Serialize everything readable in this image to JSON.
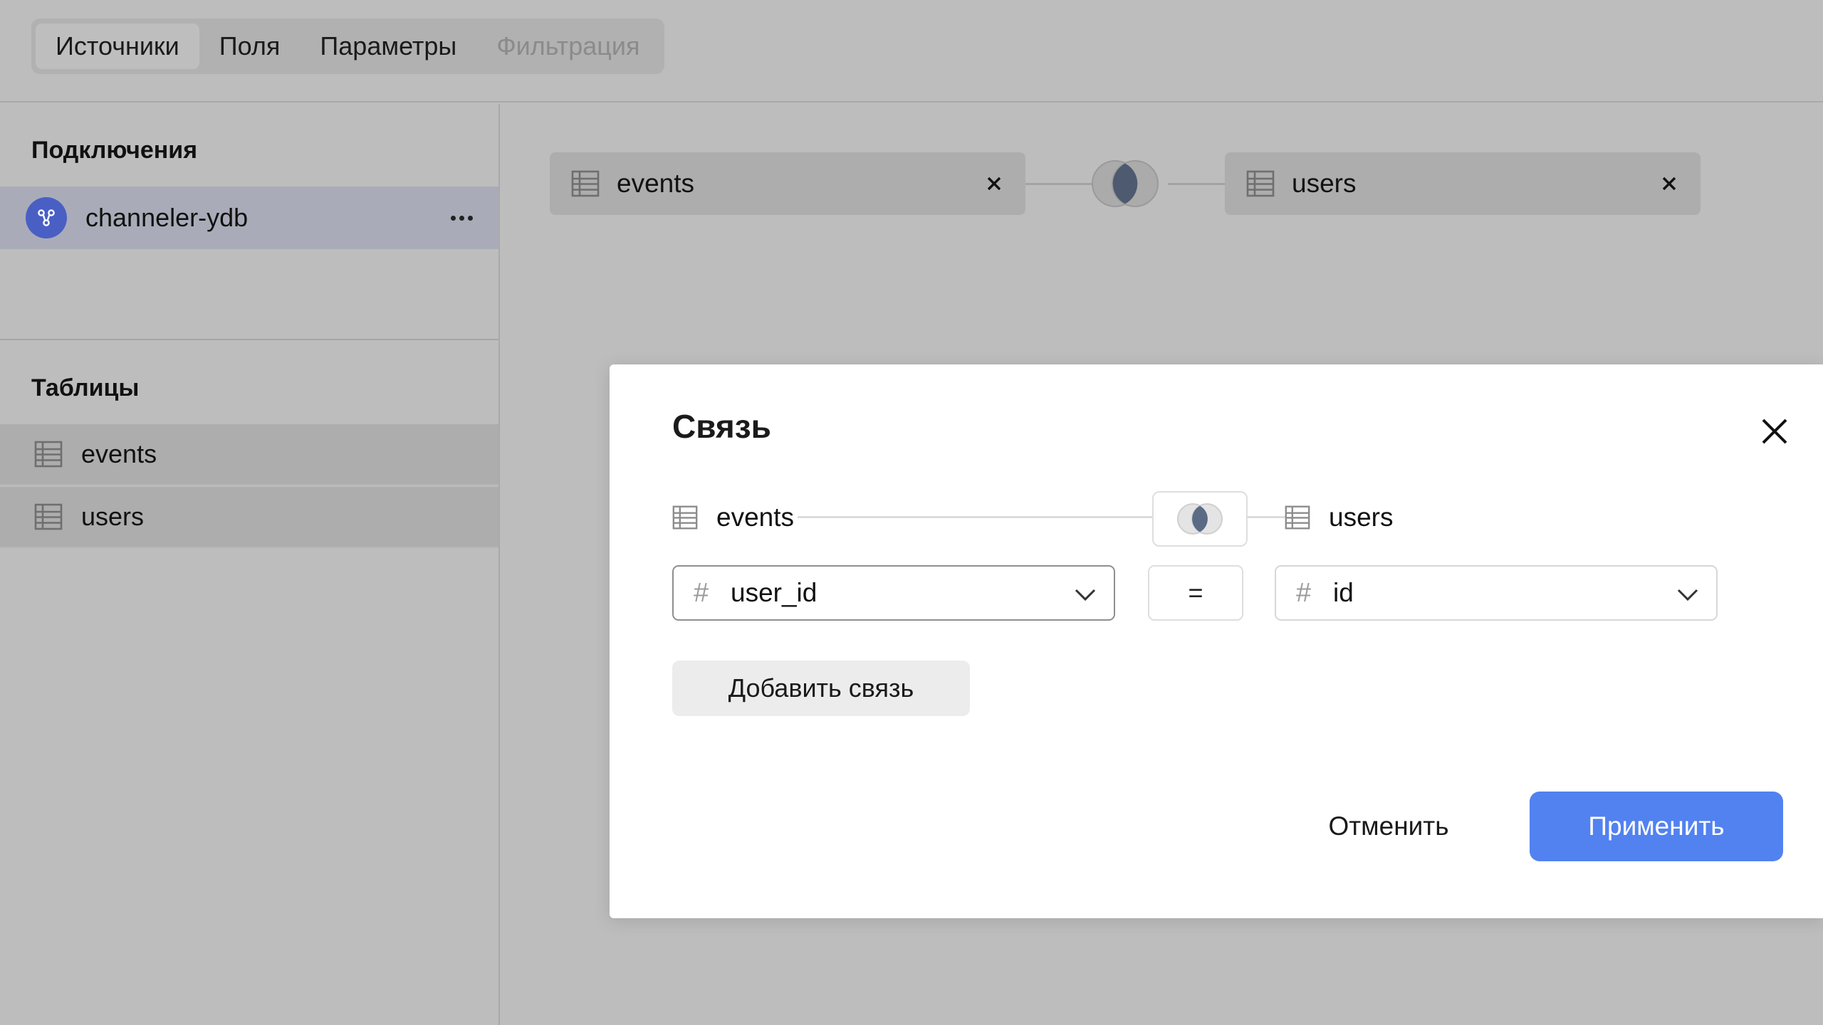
{
  "tabs": [
    {
      "label": "Источники",
      "active": true
    },
    {
      "label": "Поля"
    },
    {
      "label": "Параметры"
    },
    {
      "label": "Фильтрация",
      "disabled": true
    }
  ],
  "sidebar": {
    "connections_title": "Подключения",
    "connection": {
      "label": "channeler-ydb",
      "icon": "database-connection-icon",
      "more_icon": "more-dots-icon"
    },
    "tables_title": "Таблицы",
    "tables": [
      {
        "label": "events",
        "icon": "table-icon"
      },
      {
        "label": "users",
        "icon": "table-icon"
      }
    ]
  },
  "canvas": {
    "left_source": {
      "label": "events",
      "icon": "table-icon",
      "close_icon": "close-icon"
    },
    "right_source": {
      "label": "users",
      "icon": "table-icon",
      "close_icon": "close-icon"
    },
    "join_icon": "inner-join-icon"
  },
  "modal": {
    "title": "Связь",
    "left_table": "events",
    "right_table": "users",
    "join_type_icon": "inner-join-icon",
    "left_field": {
      "icon": "#",
      "value": "user_id"
    },
    "operator": "=",
    "right_field": {
      "icon": "#",
      "value": "id"
    },
    "add_link_label": "Добавить связь",
    "cancel_label": "Отменить",
    "apply_label": "Применить"
  },
  "colors": {
    "primary": "#5282f0",
    "overlay": "#bdbdbd",
    "selected_row": "#a9acb8",
    "avatar": "#4a5fc4"
  }
}
